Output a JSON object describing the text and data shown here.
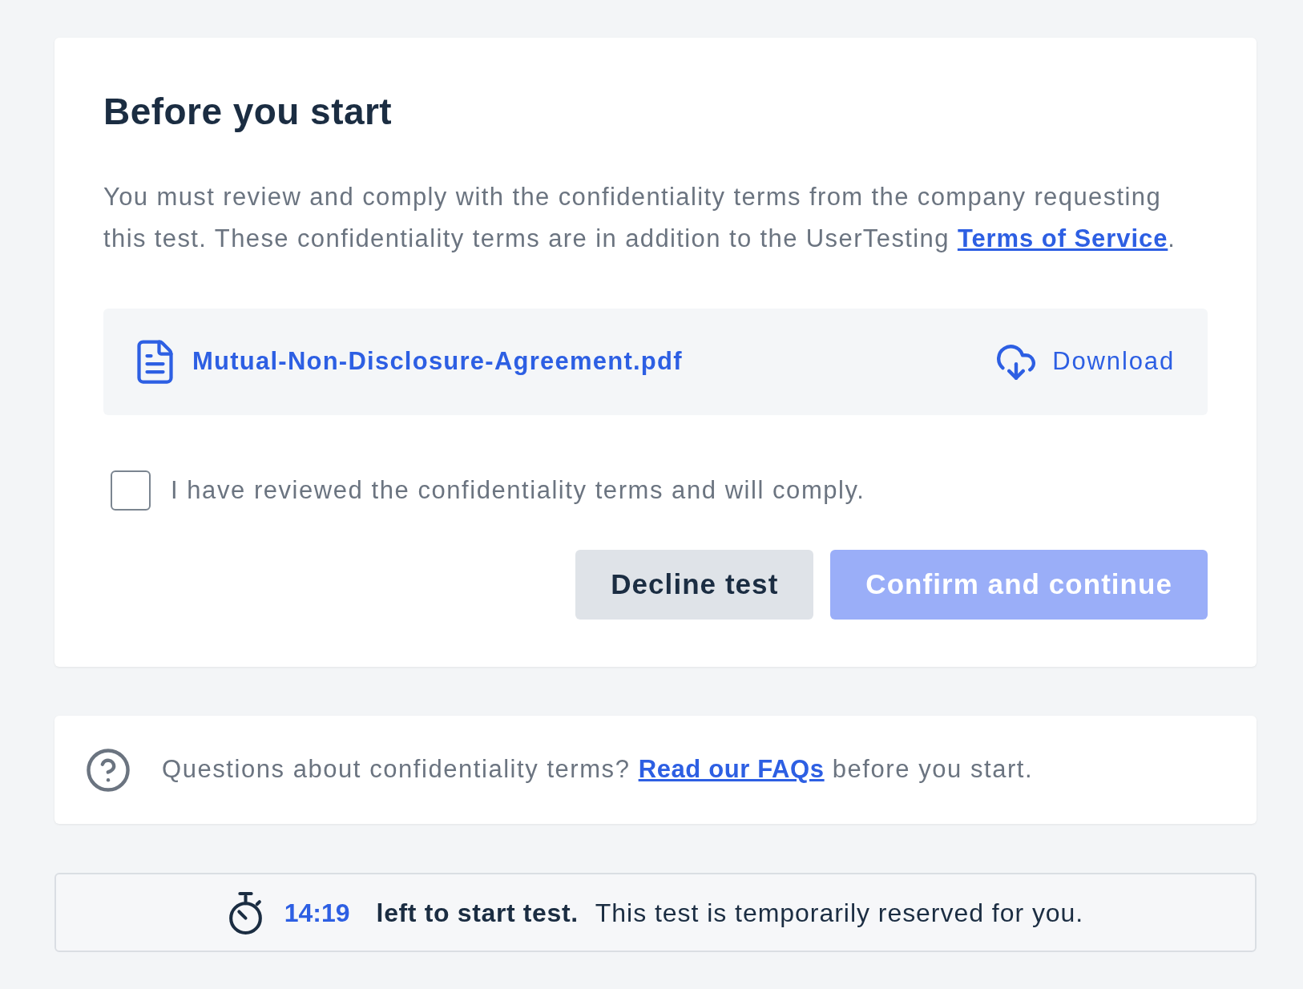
{
  "card": {
    "title": "Before you start",
    "intro": {
      "text": "You must review and comply with the confidentiality terms from the company requesting this test. These confidentiality terms are in addition to the UserTesting ",
      "link": "Terms of Service",
      "after": "."
    },
    "file": {
      "name": "Mutual-Non-Disclosure-Agreement.pdf",
      "action": "Download"
    },
    "agreement": {
      "label": "I have reviewed the confidentiality terms and will comply.",
      "checked": false
    },
    "buttons": [
      {
        "label": "Decline test",
        "kind": "secondary",
        "disabled": false
      },
      {
        "label": "Confirm and continue",
        "kind": "primary",
        "disabled": true
      }
    ]
  },
  "faq": {
    "text": "Questions about confidentiality terms? ",
    "link": "Read our FAQs",
    "after": " before you start."
  },
  "timer": {
    "time": "14:19",
    "label": "left to start test.",
    "note": "This test is temporarily reserved for you."
  }
}
